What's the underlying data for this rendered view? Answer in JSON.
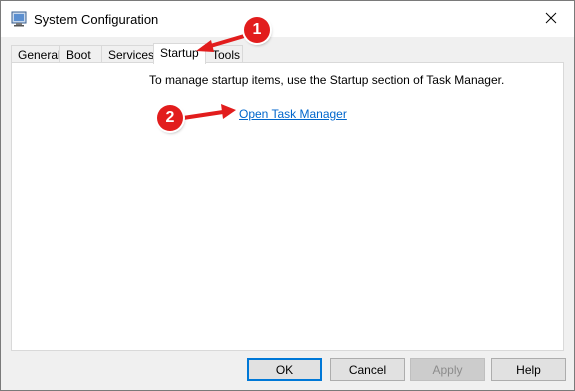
{
  "window": {
    "title": "System Configuration",
    "close_icon": "close-icon"
  },
  "tabs": [
    {
      "label": "General"
    },
    {
      "label": "Boot"
    },
    {
      "label": "Services"
    },
    {
      "label": "Startup",
      "active": true
    },
    {
      "label": "Tools"
    }
  ],
  "startup": {
    "message": "To manage startup items, use the Startup section of Task Manager.",
    "link_label": "Open Task Manager"
  },
  "buttons": {
    "ok": "OK",
    "cancel": "Cancel",
    "apply": "Apply",
    "help": "Help"
  },
  "annotations": [
    {
      "label": "1"
    },
    {
      "label": "2"
    }
  ],
  "colors": {
    "annotation": "#e21d1d",
    "link": "#0066cc",
    "focus": "#0078d7"
  }
}
